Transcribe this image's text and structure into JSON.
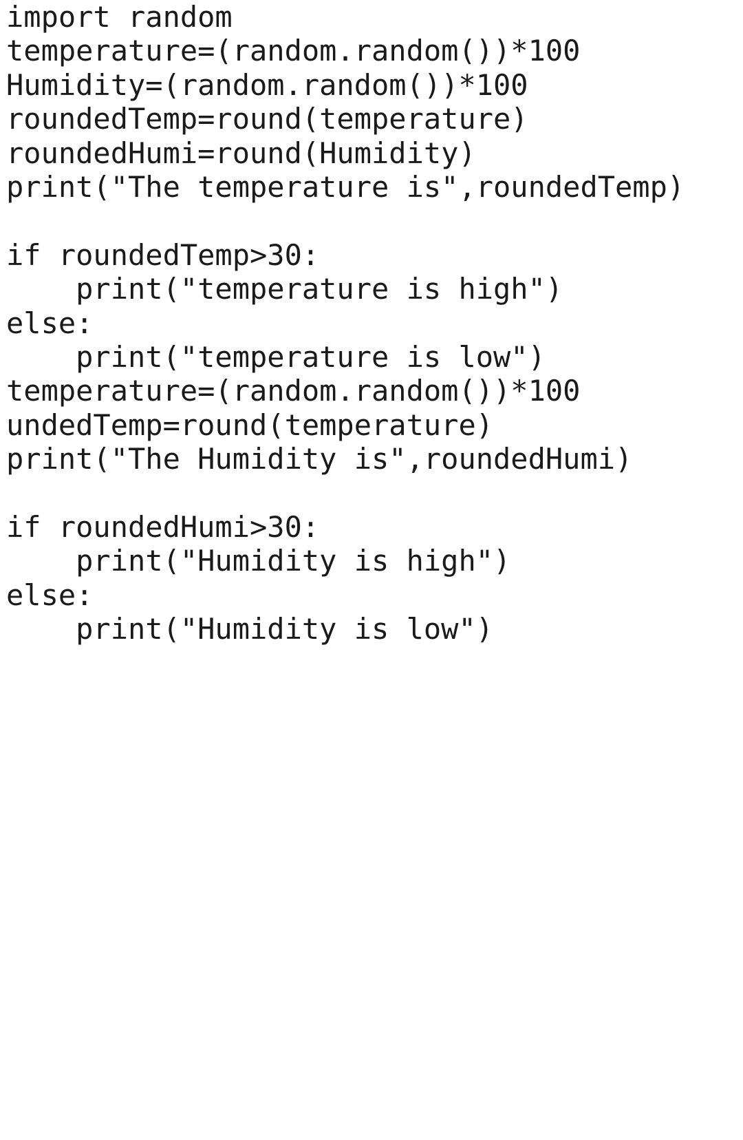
{
  "code_lines": [
    "import random",
    "temperature=(random.random())*100",
    "Humidity=(random.random())*100",
    "roundedTemp=round(temperature)",
    "roundedHumi=round(Humidity)",
    "print(\"The temperature is\",roundedTemp)",
    "",
    "if roundedTemp>30:",
    "    print(\"temperature is high\")",
    "else:",
    "    print(\"temperature is low\")",
    "temperature=(random.random())*100",
    "undedTemp=round(temperature)",
    "print(\"The Humidity is\",roundedHumi)",
    "",
    "if roundedHumi>30:",
    "    print(\"Humidity is high\")",
    "else:",
    "    print(\"Humidity is low\")"
  ]
}
